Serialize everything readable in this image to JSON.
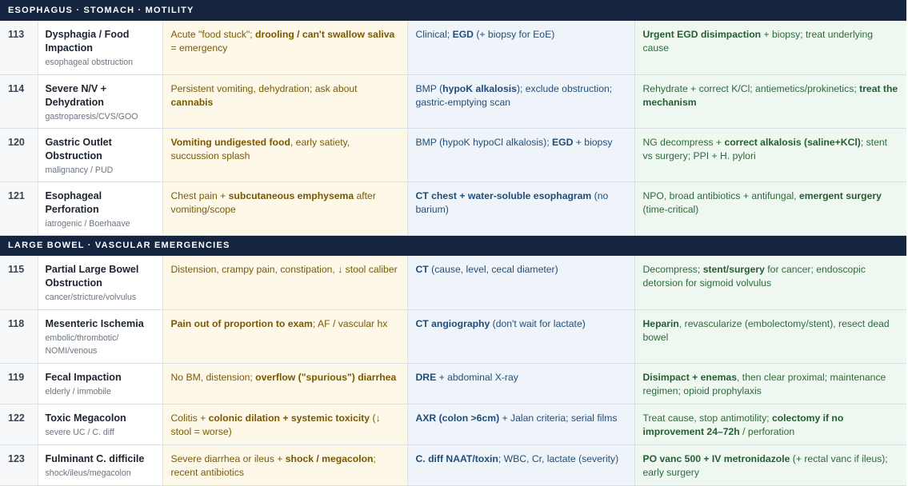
{
  "sections": [
    {
      "title": "ESOPHAGUS · STOMACH · MOTILITY",
      "rows": [
        {
          "num": "113",
          "name": "Dysphagia / Food Impaction",
          "sub": "esophageal obstruction",
          "pres": [
            {
              "t": "Acute \"food stuck\"; "
            },
            {
              "t": "drooling / can't swallow saliva",
              "b": true
            },
            {
              "t": " = emergency"
            }
          ],
          "work": [
            {
              "t": "Clinical; "
            },
            {
              "t": "EGD",
              "b": true
            },
            {
              "t": " (+ biopsy for EoE)"
            }
          ],
          "mgmt": [
            {
              "t": "Urgent EGD disimpaction",
              "b": true
            },
            {
              "t": " + biopsy; treat underlying cause"
            }
          ]
        },
        {
          "num": "114",
          "name": "Severe N/V + Dehydration",
          "sub": "gastroparesis/CVS/GOO",
          "pres": [
            {
              "t": "Persistent vomiting, dehydration; ask about "
            },
            {
              "t": "cannabis",
              "b": true
            }
          ],
          "work": [
            {
              "t": "BMP ("
            },
            {
              "t": "hypoK alkalosis",
              "b": true
            },
            {
              "t": "); exclude obstruction; gastric-emptying scan"
            }
          ],
          "mgmt": [
            {
              "t": "Rehydrate + correct K/Cl; antiemetics/prokinetics; "
            },
            {
              "t": "treat the mechanism",
              "b": true
            }
          ]
        },
        {
          "num": "120",
          "name": "Gastric Outlet Obstruction",
          "sub": "malignancy / PUD",
          "pres": [
            {
              "t": "Vomiting undigested food",
              "b": true
            },
            {
              "t": ", early satiety, succussion splash"
            }
          ],
          "work": [
            {
              "t": "BMP (hypoK hypoCl alkalosis); "
            },
            {
              "t": "EGD",
              "b": true
            },
            {
              "t": " + biopsy"
            }
          ],
          "mgmt": [
            {
              "t": "NG decompress + "
            },
            {
              "t": "correct alkalosis (saline+KCl)",
              "b": true
            },
            {
              "t": "; stent vs surgery; PPI + H. pylori"
            }
          ]
        },
        {
          "num": "121",
          "name": "Esophageal Perforation",
          "sub": "iatrogenic / Boerhaave",
          "pres": [
            {
              "t": "Chest pain + "
            },
            {
              "t": "subcutaneous emphysema",
              "b": true
            },
            {
              "t": " after vomiting/scope"
            }
          ],
          "work": [
            {
              "t": "CT chest + water-soluble esophagram",
              "b": true
            },
            {
              "t": " (no barium)"
            }
          ],
          "mgmt": [
            {
              "t": "NPO, broad antibiotics + antifungal, "
            },
            {
              "t": "emergent surgery",
              "b": true
            },
            {
              "t": " (time-critical)"
            }
          ]
        }
      ]
    },
    {
      "title": "LARGE BOWEL · VASCULAR EMERGENCIES",
      "rows": [
        {
          "num": "115",
          "name": "Partial Large Bowel Obstruction",
          "sub": "cancer/stricture/volvulus",
          "pres": [
            {
              "t": "Distension, crampy pain, constipation, ↓ stool caliber"
            }
          ],
          "work": [
            {
              "t": "CT",
              "b": true
            },
            {
              "t": " (cause, level, cecal diameter)"
            }
          ],
          "mgmt": [
            {
              "t": "Decompress; "
            },
            {
              "t": "stent/surgery",
              "b": true
            },
            {
              "t": " for cancer; endoscopic detorsion for sigmoid volvulus"
            }
          ]
        },
        {
          "num": "118",
          "name": "Mesenteric Ischemia",
          "sub": "embolic/thrombotic/ NOMI/venous",
          "pres": [
            {
              "t": "Pain out of proportion to exam",
              "b": true
            },
            {
              "t": "; AF / vascular hx"
            }
          ],
          "work": [
            {
              "t": "CT angiography",
              "b": true
            },
            {
              "t": " (don't wait for lactate)"
            }
          ],
          "mgmt": [
            {
              "t": "Heparin",
              "b": true
            },
            {
              "t": ", revascularize (embolectomy/stent), resect dead bowel"
            }
          ]
        },
        {
          "num": "119",
          "name": "Fecal Impaction",
          "sub": "elderly / immobile",
          "pres": [
            {
              "t": "No BM, distension; "
            },
            {
              "t": "overflow (\"spurious\") diarrhea",
              "b": true
            }
          ],
          "work": [
            {
              "t": "DRE",
              "b": true
            },
            {
              "t": " + abdominal X-ray"
            }
          ],
          "mgmt": [
            {
              "t": "Disimpact + enemas",
              "b": true
            },
            {
              "t": ", then clear proximal; maintenance regimen; opioid prophylaxis"
            }
          ]
        },
        {
          "num": "122",
          "name": "Toxic Megacolon",
          "sub": "severe UC / C. diff",
          "pres": [
            {
              "t": "Colitis + "
            },
            {
              "t": "colonic dilation + systemic toxicity",
              "b": true
            },
            {
              "t": " (↓ stool = worse)"
            }
          ],
          "work": [
            {
              "t": "AXR (colon >6cm)",
              "b": true
            },
            {
              "t": " + Jalan criteria; serial films"
            }
          ],
          "mgmt": [
            {
              "t": "Treat cause, stop antimotility; "
            },
            {
              "t": "colectomy if no improvement 24–72h",
              "b": true
            },
            {
              "t": " / perforation"
            }
          ]
        },
        {
          "num": "123",
          "name": "Fulminant C. difficile",
          "sub": "shock/ileus/megacolon",
          "pres": [
            {
              "t": "Severe diarrhea or ileus + "
            },
            {
              "t": "shock / megacolon",
              "b": true
            },
            {
              "t": "; recent antibiotics"
            }
          ],
          "work": [
            {
              "t": "C. diff NAAT/toxin",
              "b": true
            },
            {
              "t": "; WBC, Cr, lactate (severity)"
            }
          ],
          "mgmt": [
            {
              "t": "PO vanc 500 + IV metronidazole",
              "b": true
            },
            {
              "t": " (+ rectal vanc if ileus); early surgery"
            }
          ]
        }
      ]
    }
  ]
}
